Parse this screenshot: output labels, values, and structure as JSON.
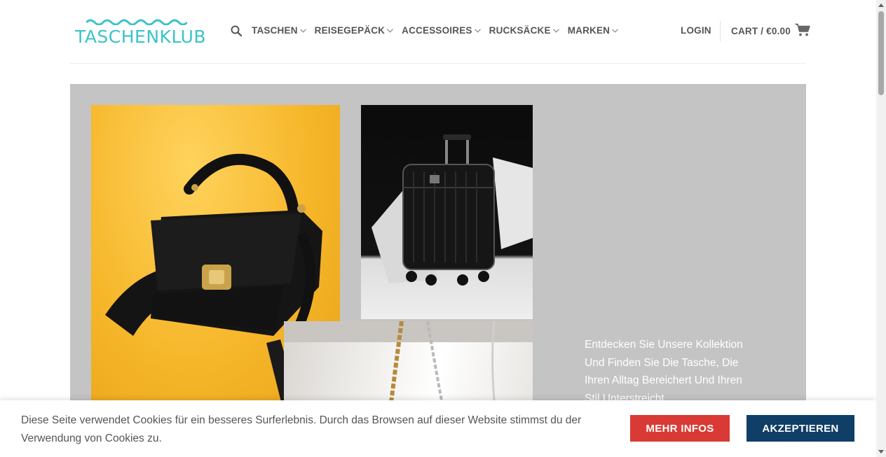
{
  "header": {
    "logo_text": "TASCHENKLUB",
    "nav": [
      {
        "label": "TASCHEN"
      },
      {
        "label": "REISEGEPÄCK"
      },
      {
        "label": "ACCESSOIRES"
      },
      {
        "label": "RUCKSÄCKE"
      },
      {
        "label": "MARKEN"
      }
    ],
    "login_label": "LOGIN",
    "cart_label": "CART / €0.00"
  },
  "hero": {
    "text": "Entdecken Sie Unsere Kollektion Und Finden Sie Die Tasche, Die Ihren Alltag Bereichert Und Ihren Stil Unterstreicht",
    "images": [
      "black-croc-handbag",
      "black-carry-on-luggage",
      "chain-strap-bag"
    ]
  },
  "cookie": {
    "text": "Diese Seite verwendet Cookies für ein besseres Surferlebnis. Durch das Browsen auf dieser Website stimmst du der Verwendung von Cookies zu.",
    "more_label": "MEHR INFOS",
    "accept_label": "AKZEPTIEREN"
  },
  "colors": {
    "brand_teal": "#3cc3c8",
    "accept_blue": "#0f3e66",
    "more_red": "#d93a35"
  }
}
